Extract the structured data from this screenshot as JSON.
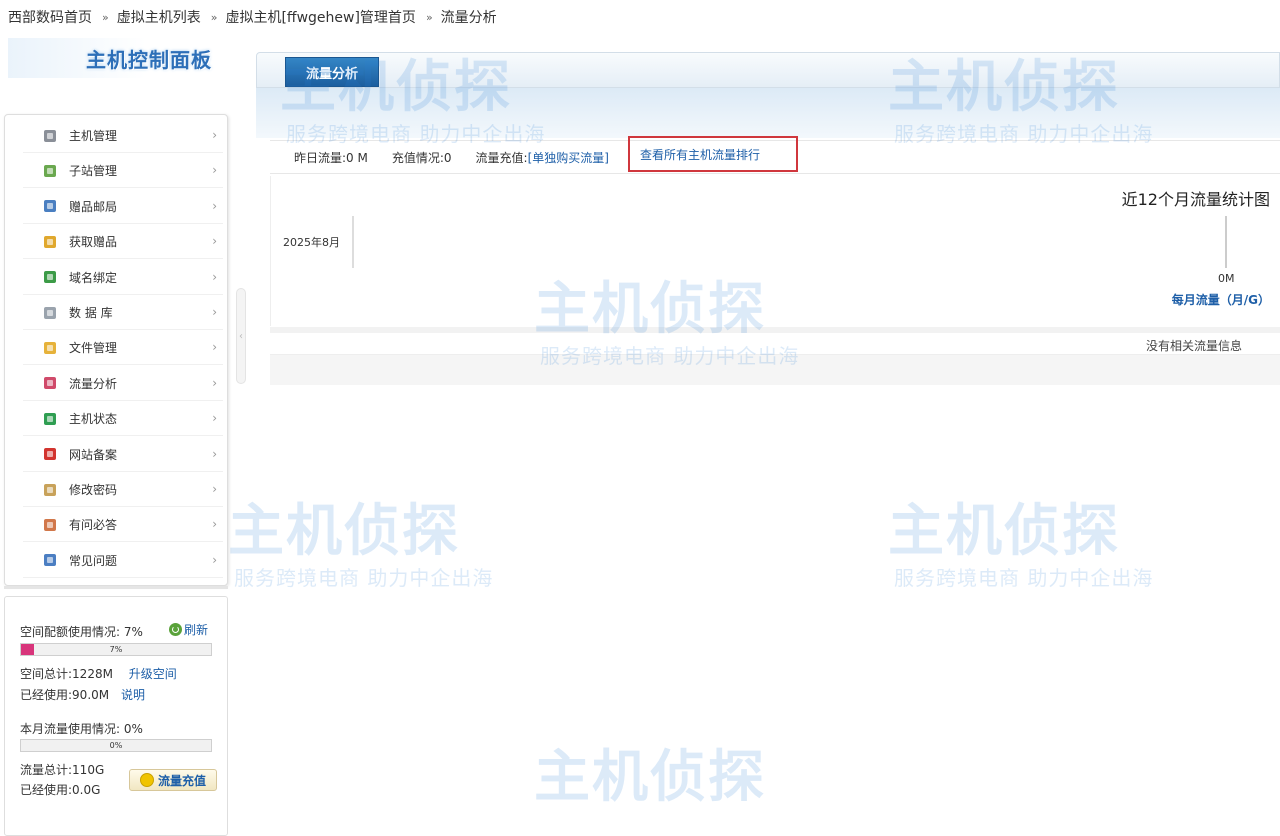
{
  "breadcrumb": {
    "items": [
      "西部数码首页",
      "虚拟主机列表",
      "虚拟主机[ffwgehew]管理首页"
    ],
    "current": "流量分析",
    "separator": "»"
  },
  "sidebar": {
    "panel_title": "主机控制面板",
    "items": [
      {
        "label": "主机管理",
        "icon": "server-icon",
        "color": "#8a8f98"
      },
      {
        "label": "子站管理",
        "icon": "subsite-icon",
        "color": "#6aa84f"
      },
      {
        "label": "赠品邮局",
        "icon": "mail-icon",
        "color": "#4a7fc1"
      },
      {
        "label": "获取赠品",
        "icon": "gift-icon",
        "color": "#e0a82e"
      },
      {
        "label": "域名绑定",
        "icon": "globe-icon",
        "color": "#3c9b47"
      },
      {
        "label": "数 据 库",
        "icon": "database-icon",
        "color": "#9aa3ad"
      },
      {
        "label": "文件管理",
        "icon": "folder-icon",
        "color": "#e6b23a"
      },
      {
        "label": "流量分析",
        "icon": "chart-icon",
        "color": "#d04a6a"
      },
      {
        "label": "主机状态",
        "icon": "status-icon",
        "color": "#2f9e52"
      },
      {
        "label": "网站备案",
        "icon": "flag-icon",
        "color": "#d2342f"
      },
      {
        "label": "修改密码",
        "icon": "key-icon",
        "color": "#c8a25a"
      },
      {
        "label": "有问必答",
        "icon": "user-help-icon",
        "color": "#d1774a"
      },
      {
        "label": "常见问题",
        "icon": "faq-icon",
        "color": "#4b7ec2"
      }
    ],
    "arrow": "›"
  },
  "usage": {
    "space_label": "空间配额使用情况: 7%",
    "refresh": "刷新",
    "space_progress": 7,
    "space_progress_text": "7%",
    "space_total": "空间总计:1228M",
    "upgrade": "升级空间",
    "space_used": "已经使用:90.0M",
    "explain": "说明",
    "traffic_label": "本月流量使用情况: 0%",
    "traffic_progress": 0,
    "traffic_progress_text": "0%",
    "traffic_total": "流量总计:110G",
    "traffic_used": "已经使用:0.0G",
    "recharge": "流量充值"
  },
  "main": {
    "tab": "流量分析",
    "yesterday": "昨日流量:0 M",
    "recharge_status": "充值情况:0",
    "traffic_recharge": "流量充值:",
    "buy_link": "[单独购买流量]",
    "rank_link": "查看所有主机流量排行",
    "no_data": "没有相关流量信息"
  },
  "chart_data": {
    "type": "bar",
    "title": "近12个月流量统计图",
    "categories": [
      "2025年8月"
    ],
    "values": [
      0
    ],
    "value_label": "0M",
    "legend": "每月流量（月/G）"
  },
  "colors": {
    "accent": "#1e5fa8",
    "tab": "#2a73b5",
    "highlight_border": "#d0373d",
    "progress": "#d8357b"
  },
  "watermark": {
    "main": "主机侦探",
    "sub": "服务跨境电商 助力中企出海"
  }
}
